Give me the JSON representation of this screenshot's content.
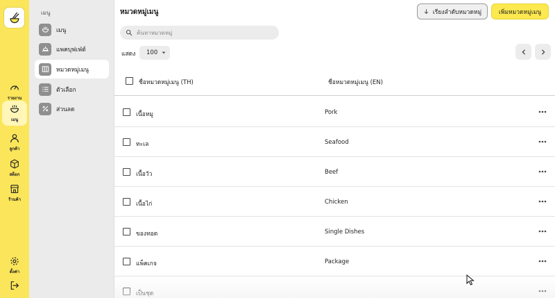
{
  "rail": {
    "items": [
      {
        "label": "รายงาน",
        "icon": "gauge-icon"
      },
      {
        "label": "เมนู",
        "icon": "bowl-icon"
      },
      {
        "label": "ลูกค้า",
        "icon": "user-icon"
      },
      {
        "label": "สต็อก",
        "icon": "box-icon"
      },
      {
        "label": "ร้านค้า",
        "icon": "store-icon"
      }
    ],
    "settings_label": "ตั้งค่า",
    "logout_icon": "logout-icon"
  },
  "subnav": {
    "title": "เมนู",
    "items": [
      {
        "label": "เมนู",
        "icon": "bowl-icon"
      },
      {
        "label": "แพคบุฟเฟ่ต์",
        "icon": "cloche-icon"
      },
      {
        "label": "หมวดหมู่เมนู",
        "icon": "columns-icon"
      },
      {
        "label": "ตัวเลือก",
        "icon": "list-icon"
      },
      {
        "label": "ส่วนลด",
        "icon": "percent-icon"
      }
    ]
  },
  "header": {
    "title": "หมวดหมู่เมนู",
    "sort_button": "เรียงลำดับหมวดหมู่",
    "add_button": "เพิ่มหมวดหมู่เมนู"
  },
  "search": {
    "placeholder": "ค้นหาหมวดหมู่",
    "value": ""
  },
  "pagination": {
    "show_label": "แสดง",
    "page_size": "100"
  },
  "table": {
    "columns": {
      "th": "ชื่อหมวดหมู่เมนู (TH)",
      "en": "ชื่อหมวดหมู่เมนู (EN)"
    },
    "rows": [
      {
        "th": "เนื้อหมู",
        "en": "Pork"
      },
      {
        "th": "ทะเล",
        "en": "Seafood"
      },
      {
        "th": "เนื้อวัว",
        "en": "Beef"
      },
      {
        "th": "เนื้อไก่",
        "en": "Chicken"
      },
      {
        "th": "ของทอด",
        "en": "Single Dishes"
      },
      {
        "th": "แพ็คเกจ",
        "en": "Package"
      },
      {
        "th": "เป็นชุด",
        "en": ""
      }
    ]
  },
  "colors": {
    "accent": "#fce94f",
    "rail": "#fbe55a",
    "subnav": "#ebebeb"
  }
}
